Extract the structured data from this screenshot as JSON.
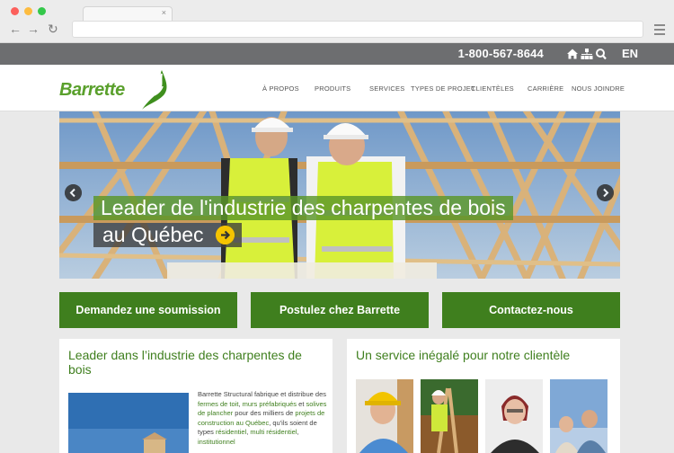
{
  "browser": {
    "tab_close": "×",
    "back": "←",
    "forward": "→",
    "reload": "↻"
  },
  "topbar": {
    "phone": "1-800-567-8644",
    "language": "EN",
    "icons": [
      "home-icon",
      "sitemap-icon",
      "search-icon"
    ]
  },
  "header": {
    "logo_text": "Barrette",
    "nav": [
      "À PROPOS",
      "PRODUITS",
      "SERVICES",
      "TYPES DE PROJET",
      "CLIENTÈLES",
      "CARRIÈRE",
      "NOUS JOINDRE"
    ]
  },
  "hero": {
    "caption_line1": "Leader de l'industrie des charpentes de bois",
    "caption_line2": "au Québec"
  },
  "cta": {
    "quote": "Demandez une soumission",
    "apply": "Postulez chez Barrette",
    "contact": "Contactez-nous"
  },
  "left_card": {
    "title_line1": "Leader dans l’industrie des charpentes de",
    "title_line2": "bois",
    "body": {
      "t1": "Barrette Structural fabrique et distribue des ",
      "l1": "fermes de toit",
      "t2": ", ",
      "l2": "murs préfabriqués",
      "t3": " et ",
      "l3": "solives de plancher",
      "t4": " pour des milliers de ",
      "l4": "projets de construction au Québec",
      "t5": ", qu'ils soient de types ",
      "l5": "résidentiel",
      "t6": ", ",
      "l6": "multi résidentiel",
      "t7": ", ",
      "l7": "institutionnel"
    }
  },
  "right_card": {
    "title": "Un service inégalé pour notre clientèle"
  },
  "colors": {
    "brand_green": "#3f7f1e",
    "logo_green": "#5aa02c",
    "topbar_gray": "#6d6e70",
    "accent_yellow": "#f5c400"
  }
}
